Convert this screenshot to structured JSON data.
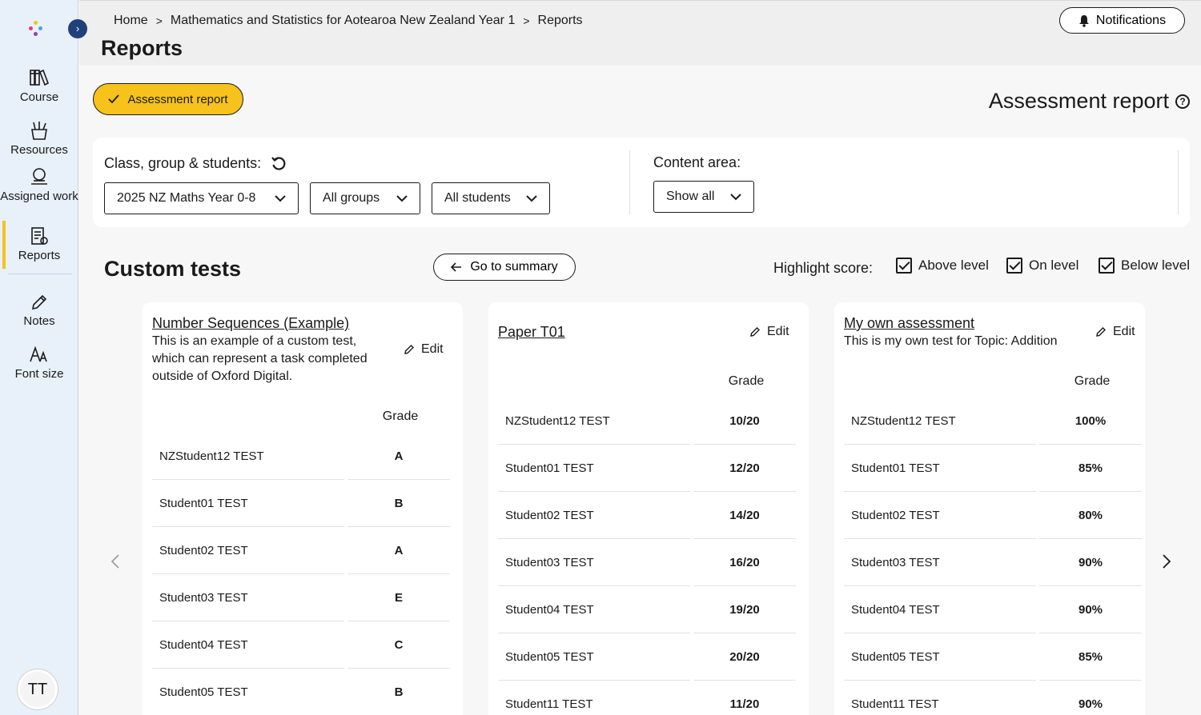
{
  "sidebar": {
    "items": [
      {
        "label": "Course",
        "icon": "books-icon"
      },
      {
        "label": "Resources",
        "icon": "resources-icon"
      },
      {
        "label": "Assigned work",
        "icon": "assigned-work-icon"
      },
      {
        "label": "Reports",
        "icon": "reports-icon"
      },
      {
        "label": "Notes",
        "icon": "pencil-icon"
      },
      {
        "label": "Font size",
        "icon": "font-size-icon"
      }
    ],
    "active": "Reports",
    "avatar_initials": "TT"
  },
  "header": {
    "breadcrumb": [
      "Home",
      "Mathematics and Statistics for Aotearoa New Zealand Year 1",
      "Reports"
    ],
    "title": "Reports",
    "notifications_label": "Notifications"
  },
  "report": {
    "chip_label": "Assessment report",
    "title": "Assessment report"
  },
  "filters": {
    "class_label": "Class, group & students:",
    "class_value": "2025 NZ Maths Year 0-8",
    "group_value": "All groups",
    "student_value": "All students",
    "content_label": "Content area:",
    "content_value": "Show all"
  },
  "section": {
    "title": "Custom tests",
    "summary_label": "Go to summary",
    "highlight_label": "Highlight score:",
    "options": [
      "Above level",
      "On level",
      "Below level"
    ]
  },
  "cards": [
    {
      "title": "Number Sequences (Example)",
      "description": "This is an example of a custom test, which can represent a task completed outside of Oxford Digital.",
      "edit_label": "Edit",
      "grade_header": "Grade",
      "rows": [
        {
          "name": "NZStudent12 TEST",
          "grade": "A"
        },
        {
          "name": "Student01 TEST",
          "grade": "B"
        },
        {
          "name": "Student02 TEST",
          "grade": "A"
        },
        {
          "name": "Student03 TEST",
          "grade": "E"
        },
        {
          "name": "Student04 TEST",
          "grade": "C"
        },
        {
          "name": "Student05 TEST",
          "grade": "B"
        }
      ]
    },
    {
      "title": "Paper T01",
      "description": "",
      "edit_label": "Edit",
      "grade_header": "Grade",
      "rows": [
        {
          "name": "NZStudent12 TEST",
          "grade": "10/20"
        },
        {
          "name": "Student01 TEST",
          "grade": "12/20"
        },
        {
          "name": "Student02 TEST",
          "grade": "14/20"
        },
        {
          "name": "Student03 TEST",
          "grade": "16/20"
        },
        {
          "name": "Student04 TEST",
          "grade": "19/20"
        },
        {
          "name": "Student05 TEST",
          "grade": "20/20"
        },
        {
          "name": "Student11 TEST",
          "grade": "11/20"
        }
      ]
    },
    {
      "title": "My own assessment",
      "description": "This is my own test for Topic: Addition",
      "edit_label": "Edit",
      "grade_header": "Grade",
      "rows": [
        {
          "name": "NZStudent12 TEST",
          "grade": "100%"
        },
        {
          "name": "Student01 TEST",
          "grade": "85%"
        },
        {
          "name": "Student02 TEST",
          "grade": "80%"
        },
        {
          "name": "Student03 TEST",
          "grade": "90%"
        },
        {
          "name": "Student04 TEST",
          "grade": "90%"
        },
        {
          "name": "Student05 TEST",
          "grade": "85%"
        },
        {
          "name": "Student11 TEST",
          "grade": "90%"
        }
      ]
    }
  ],
  "colors": {
    "accent": "#f6c21b",
    "sidebar_bg": "#e8f0f9",
    "nav_toggle": "#21407a"
  }
}
